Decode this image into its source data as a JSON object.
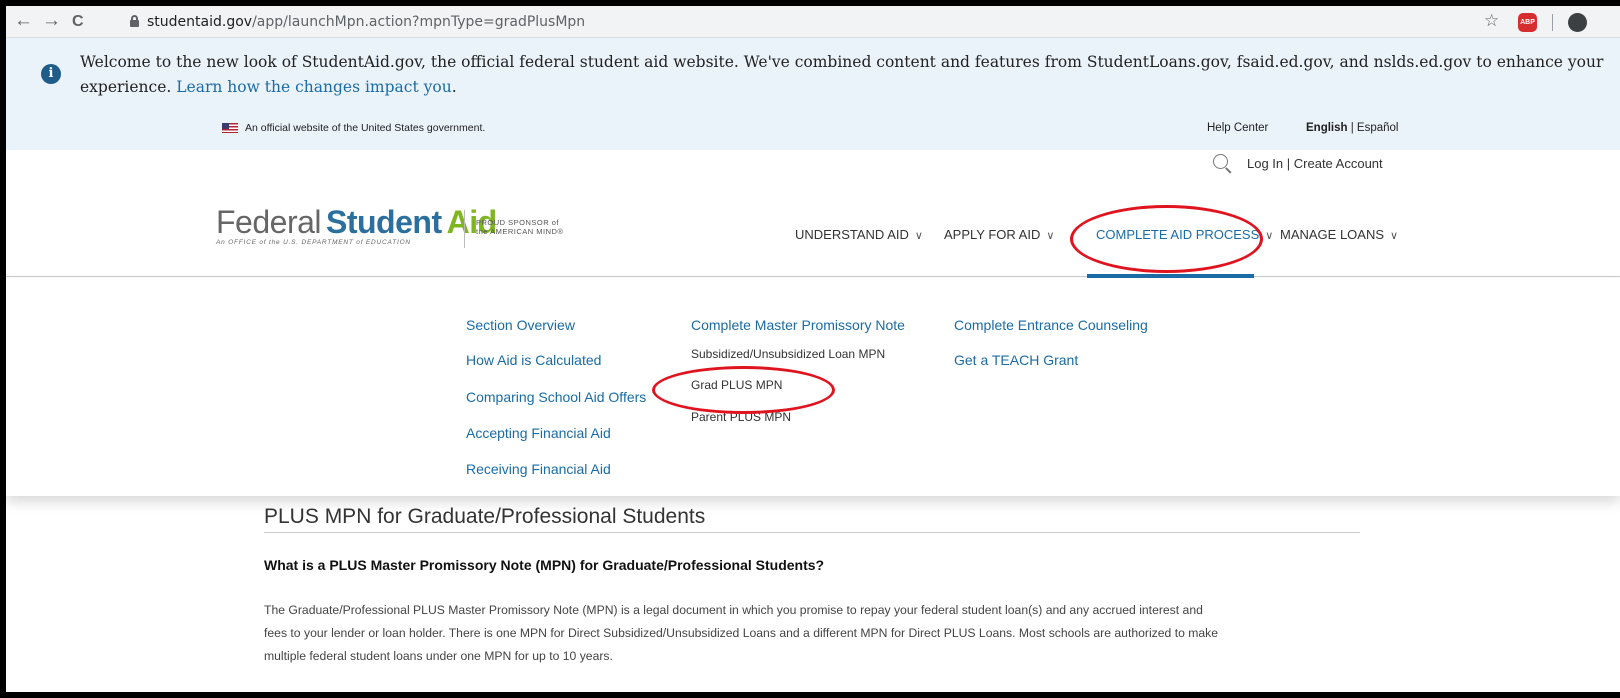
{
  "browser": {
    "back_glyph": "←",
    "forward_glyph": "→",
    "reload_glyph": "C",
    "url_host": "studentaid.gov",
    "url_path": "/app/launchMpn.action?mpnType=gradPlusMpn",
    "star_glyph": "☆",
    "abp_label": "ABP"
  },
  "banner": {
    "icon_glyph": "i",
    "line1": "Welcome to the new look of StudentAid.gov, the official federal student aid website. We've combined content and features from StudentLoans.gov, fsaid.ed.gov, and nslds.ed.gov to enhance your",
    "line2_prefix": "experience. ",
    "link_text": "Learn how the changes impact you",
    "line2_suffix": "."
  },
  "utility": {
    "official_text": "An official website of the United States government.",
    "help_center": "Help Center",
    "english": "English",
    "lang_separator": " | ",
    "espanol": "Español"
  },
  "header": {
    "login": "Log In",
    "account_separator": " | ",
    "create_account": "Create Account",
    "logo_word1": "Federal",
    "logo_word2": "Student",
    "logo_word3": "Aid",
    "logo_tagline": "An OFFICE of the U.S. DEPARTMENT of EDUCATION",
    "sponsor_line1": "PROUD SPONSOR of",
    "sponsor_line2": "the AMERICAN MIND®"
  },
  "nav": {
    "chevron": "∨",
    "items": [
      {
        "label": "UNDERSTAND AID"
      },
      {
        "label": "APPLY FOR AID"
      },
      {
        "label": "COMPLETE AID PROCESS"
      },
      {
        "label": "MANAGE LOANS"
      }
    ]
  },
  "dropdown": {
    "col1": [
      "Section Overview",
      "How Aid is Calculated",
      "Comparing School Aid Offers",
      "Accepting Financial Aid",
      "Receiving Financial Aid"
    ],
    "col2_heading": "Complete Master Promissory Note",
    "col2_items": [
      "Subsidized/Unsubsidized Loan MPN",
      "Grad PLUS MPN",
      "Parent PLUS MPN"
    ],
    "col3": [
      "Complete Entrance Counseling",
      "Get a TEACH Grant"
    ]
  },
  "content": {
    "title": "PLUS MPN for Graduate/Professional Students",
    "subheading": "What is a PLUS Master Promissory Note (MPN) for Graduate/Professional Students?",
    "para_line1": "The Graduate/Professional PLUS Master Promissory Note (MPN) is a legal document in which you promise to repay your federal student loan(s) and any accrued interest and",
    "para_line2": "fees to your lender or loan holder. There is one MPN for Direct Subsidized/Unsubsidized Loans and a different MPN for Direct PLUS Loans. Most schools are authorized to make",
    "para_line3": "multiple federal student loans under one MPN for up to 10 years."
  },
  "colors": {
    "link_blue": "#1a6ba6",
    "banner_bg": "#ebf3fa",
    "annotation_red": "#e0141e",
    "logo_green": "#7fb51e"
  }
}
